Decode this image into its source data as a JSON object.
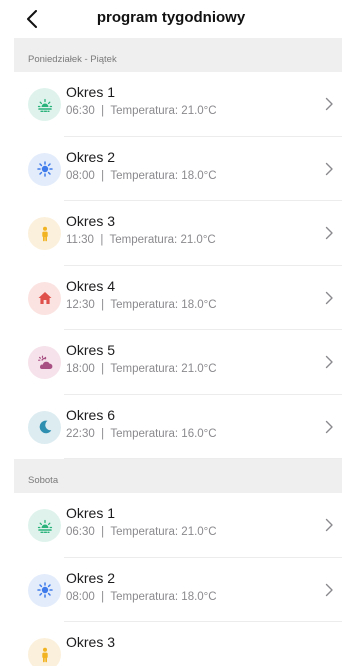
{
  "header": {
    "title": "program tygodniowy"
  },
  "sections": [
    {
      "label": "Poniedziałek - Piątek",
      "items": [
        {
          "title": "Okres 1",
          "time": "06:30",
          "temp_label": "Temperatura: 21.0°C",
          "icon": "sunrise-icon",
          "icon_bg": "#dff3ec",
          "icon_color": "#2ab27b"
        },
        {
          "title": "Okres 2",
          "time": "08:00",
          "temp_label": "Temperatura: 18.0°C",
          "icon": "sun-icon",
          "icon_bg": "#e3ecfb",
          "icon_color": "#3f7bea"
        },
        {
          "title": "Okres 3",
          "time": "11:30",
          "temp_label": "Temperatura: 21.0°C",
          "icon": "person-icon",
          "icon_bg": "#fbf0db",
          "icon_color": "#f2b322"
        },
        {
          "title": "Okres 4",
          "time": "12:30",
          "temp_label": "Temperatura: 18.0°C",
          "icon": "home-icon",
          "icon_bg": "#fbe3e1",
          "icon_color": "#e0504a"
        },
        {
          "title": "Okres 5",
          "time": "18:00",
          "temp_label": "Temperatura: 21.0°C",
          "icon": "sunset-cloud-icon",
          "icon_bg": "#f6e2ea",
          "icon_color": "#a84f84"
        },
        {
          "title": "Okres 6",
          "time": "22:30",
          "temp_label": "Temperatura: 16.0°C",
          "icon": "moon-icon",
          "icon_bg": "#dcecf1",
          "icon_color": "#2f8fb0"
        }
      ]
    },
    {
      "label": "Sobota",
      "items": [
        {
          "title": "Okres 1",
          "time": "06:30",
          "temp_label": "Temperatura: 21.0°C",
          "icon": "sunrise-icon",
          "icon_bg": "#dff3ec",
          "icon_color": "#2ab27b"
        },
        {
          "title": "Okres 2",
          "time": "08:00",
          "temp_label": "Temperatura: 18.0°C",
          "icon": "sun-icon",
          "icon_bg": "#e3ecfb",
          "icon_color": "#3f7bea"
        },
        {
          "title": "Okres 3",
          "time": "",
          "temp_label": "",
          "icon": "person-icon",
          "icon_bg": "#fbf0db",
          "icon_color": "#f2b322"
        }
      ]
    }
  ]
}
